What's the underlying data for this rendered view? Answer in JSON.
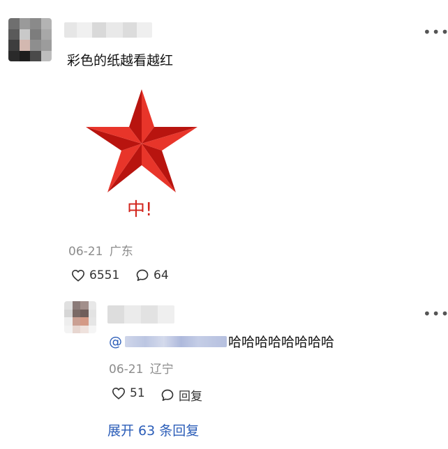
{
  "post": {
    "author_name": "",
    "text": "彩色的纸越看越红",
    "image_caption": "中!",
    "date": "06-21",
    "location": "广东",
    "likes": "6551",
    "comments": "64",
    "more_icon": "ellipsis-icon"
  },
  "reply": {
    "mention_prefix": "@",
    "text": "哈哈哈哈哈哈哈哈",
    "date": "06-21",
    "location": "辽宁",
    "likes": "51",
    "reply_label": "回复",
    "more_icon": "ellipsis-icon"
  },
  "expand_replies": {
    "label": "展开 63 条回复"
  },
  "colors": {
    "star_red": "#d2241c",
    "link_blue": "#2b5db8",
    "meta_gray": "#8c8c8c"
  }
}
